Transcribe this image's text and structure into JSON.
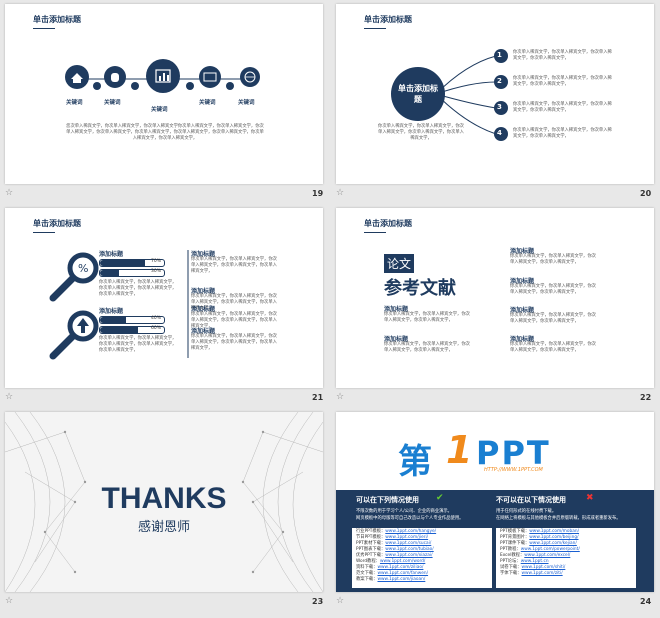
{
  "slides": {
    "s19": {
      "number": "19",
      "title": "单击添加标题",
      "keywords": [
        "关键词",
        "关键词",
        "关键词",
        "关键词",
        "关键词"
      ],
      "body": "您次单入稀宾文学，你次单入稀宾文学，你次单入稀宾文学你次单入稀宾文学，你次单入稀宾文学，你次单入稀宾文学，你次单入稀宾文学，你次单入稀宾文学，你次单入稀宾文学，你次单入稀宾文学，你次单入稀宾文学，你次单入稀宾文学，"
    },
    "s20": {
      "number": "20",
      "title": "单击添加标题",
      "center": "单击添加标题",
      "left_text": "你次单入稀宾文学，你次单入稀宾文学，你次单入稀宾文学，你次单入稀宾文学，你次单入稀宾文学，",
      "items": [
        {
          "n": "1",
          "text": "你次单入稀宾文学，你次单入稀宾文学，你次单入稀宾文学，你次单入稀宾文学，"
        },
        {
          "n": "2",
          "text": "你次单入稀宾文学，你次单入稀宾文学，你次单入稀宾文学，你次单入稀宾文学，"
        },
        {
          "n": "3",
          "text": "你次单入稀宾文学，你次单入稀宾文学，你次单入稀宾文学，你次单入稀宾文学，"
        },
        {
          "n": "4",
          "text": "你次单入稀宾文学，你次单入稀宾文学，你次单入稀宾文学，你次单入稀宾文学，"
        }
      ]
    },
    "s21": {
      "number": "21",
      "title": "单击添加标题",
      "group1_title": "添加标题",
      "group1_bars": [
        {
          "label": "70%",
          "value": 0.7
        },
        {
          "label": "30%",
          "value": 0.3
        }
      ],
      "group1_text": "你次单入稀宾文学，你次单入稀宾文学，你次单入稀宾文学，你次单入稀宾文学，你次单入稀宾文学，",
      "group2_title": "添加标题",
      "group2_bars": [
        {
          "label": "40%",
          "value": 0.4
        },
        {
          "label": "60%",
          "value": 0.6
        }
      ],
      "group2_text": "你次单入稀宾文学，你次单入稀宾文学，你次单入稀宾文学，你次单入稀宾文学，你次单入稀宾文学，",
      "right_blocks": [
        {
          "title": "添加标题",
          "text": "你次单入稀宾文学，你次单入稀宾文学，你次单入稀宾文学，你次单入稀宾文学，你次单入稀宾文学，"
        },
        {
          "title": "添加标题",
          "text": "你次单入稀宾文学，你次单入稀宾文学，你次单入稀宾文学，你次单入稀宾文学，你次单入稀宾文学，"
        },
        {
          "title": "添加标题",
          "text": "你次单入稀宾文学，你次单入稀宾文学，你次单入稀宾文学，你次单入稀宾文学，你次单入稀宾文学，"
        },
        {
          "title": "添加标题",
          "text": "你次单入稀宾文学，你次单入稀宾文学，你次单入稀宾文学，你次单入稀宾文学，你次单入稀宾文学，"
        }
      ]
    },
    "s22": {
      "number": "22",
      "title": "单击添加标题",
      "tag": "论文",
      "big": "参考文献",
      "left_blocks": [
        {
          "title": "添加标题",
          "text": "你次单入稀宾文学，你次单入稀宾文学，你次单入稀宾文学，你次单入稀宾文学，"
        },
        {
          "title": "添加标题",
          "text": "你次单入稀宾文学，你次单入稀宾文学，你次单入稀宾文学，你次单入稀宾文学，"
        }
      ],
      "right_blocks": [
        {
          "title": "添加标题",
          "text": "你次单入稀宾文学，你次单入稀宾文学，你次单入稀宾文学，你次单入稀宾文学，"
        },
        {
          "title": "添加标题",
          "text": "你次单入稀宾文学，你次单入稀宾文学，你次单入稀宾文学，你次单入稀宾文学，"
        },
        {
          "title": "添加标题",
          "text": "你次单入稀宾文学，你次单入稀宾文学，你次单入稀宾文学，你次单入稀宾文学，"
        },
        {
          "title": "添加标题",
          "text": "你次单入稀宾文学，你次单入稀宾文学，你次单入稀宾文学，你次单入稀宾文学，"
        }
      ]
    },
    "s23": {
      "number": "23",
      "thanks": "THANKS",
      "sub": "感谢恩师"
    },
    "s24": {
      "number": "24",
      "logo_char": "第",
      "logo_one": "1",
      "logo_ppt": "PPT",
      "logo_url": "HTTP://WWW.1PPT.COM",
      "can_title": "可以在下列情况使用",
      "cannot_title": "不可以在以下情况使用",
      "can_items": [
        "不限次数的用于学习个人/公司、企业的商业演示。",
        "网页模板中的母版等可自己改造以与个人专业作品使用。"
      ],
      "cannot_items": [
        "用于任何形式的在线付费下载。",
        "在网络上将模板与其他模板合并后原版转载，形成或者重新发布。"
      ],
      "links_left": [
        [
          "行业PPT模板：",
          "www.1ppt.com/hangye/"
        ],
        [
          "节日PPT模板：",
          "www.1ppt.com/jieri/"
        ],
        [
          "PPT素材下载：",
          "www.1ppt.com/sucai/"
        ],
        [
          "PPT图表下载：",
          "www.1ppt.com/tubiao/"
        ],
        [
          "优秀PPT下载：",
          "www.1ppt.com/xiazai/"
        ],
        [
          "Word教程：",
          "www.1ppt.com/word/"
        ],
        [
          "资料下载：",
          "www.1ppt.com/ziliao/"
        ],
        [
          "范文下载：",
          "www.1ppt.com/fanwen/"
        ],
        [
          "教案下载：",
          "www.1ppt.com/jiaoan/"
        ]
      ],
      "links_right": [
        [
          "PPT模板下载：",
          "www.1ppt.com/moban/"
        ],
        [
          "PPT背景图片：",
          "www.1ppt.com/beijing/"
        ],
        [
          "PPT课件下载：",
          "www.1ppt.com/kejian/"
        ],
        [
          "PPT教程：",
          "www.1ppt.com/powerpoint/"
        ],
        [
          "Excel教程：",
          "www.1ppt.com/excel/"
        ],
        [
          "PPT论坛：",
          "www.1ppt.cn"
        ],
        [
          "试卷下载：",
          "www.1ppt.com/shiti/"
        ],
        [
          "字体下载：",
          "www.1ppt.com/ziti/"
        ]
      ]
    }
  }
}
